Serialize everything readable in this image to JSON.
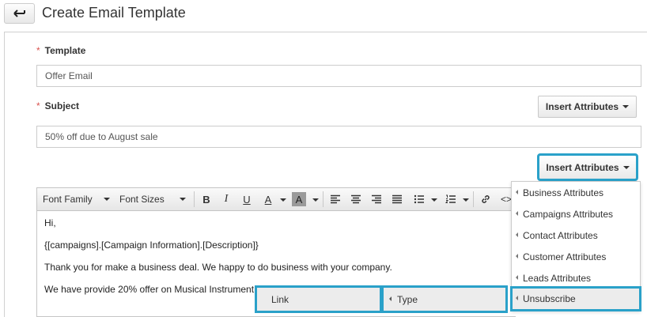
{
  "header": {
    "title": "Create Email Template"
  },
  "form": {
    "template_label": "Template",
    "required_mark": "*",
    "template_value": "Offer Email",
    "subject_label": "Subject",
    "subject_value": "50% off due to August sale",
    "insert_attributes_label": "Insert Attributes"
  },
  "toolbar": {
    "font_family": "Font Family",
    "font_sizes": "Font Sizes",
    "bold": "B",
    "italic": "I",
    "underline": "U",
    "text_color": "A",
    "bg_color": "A"
  },
  "editor_body": {
    "lines": [
      "Hi,",
      "{[campaigns].[Campaign Information].[Description]}",
      "Thank you for make a business deal. We happy to do business with your company.",
      "We have provide 20% offer on Musical Instrument"
    ]
  },
  "attributes_menu": {
    "items": [
      "Business Attributes",
      "Campaigns Attributes",
      "Contact Attributes",
      "Customer Attributes",
      "Leads Attributes",
      "Unsubscribe"
    ]
  },
  "context_menu": {
    "link": "Link",
    "type": "Type"
  },
  "colors": {
    "highlight": "#2aa1c9",
    "required": "#d9534f"
  }
}
